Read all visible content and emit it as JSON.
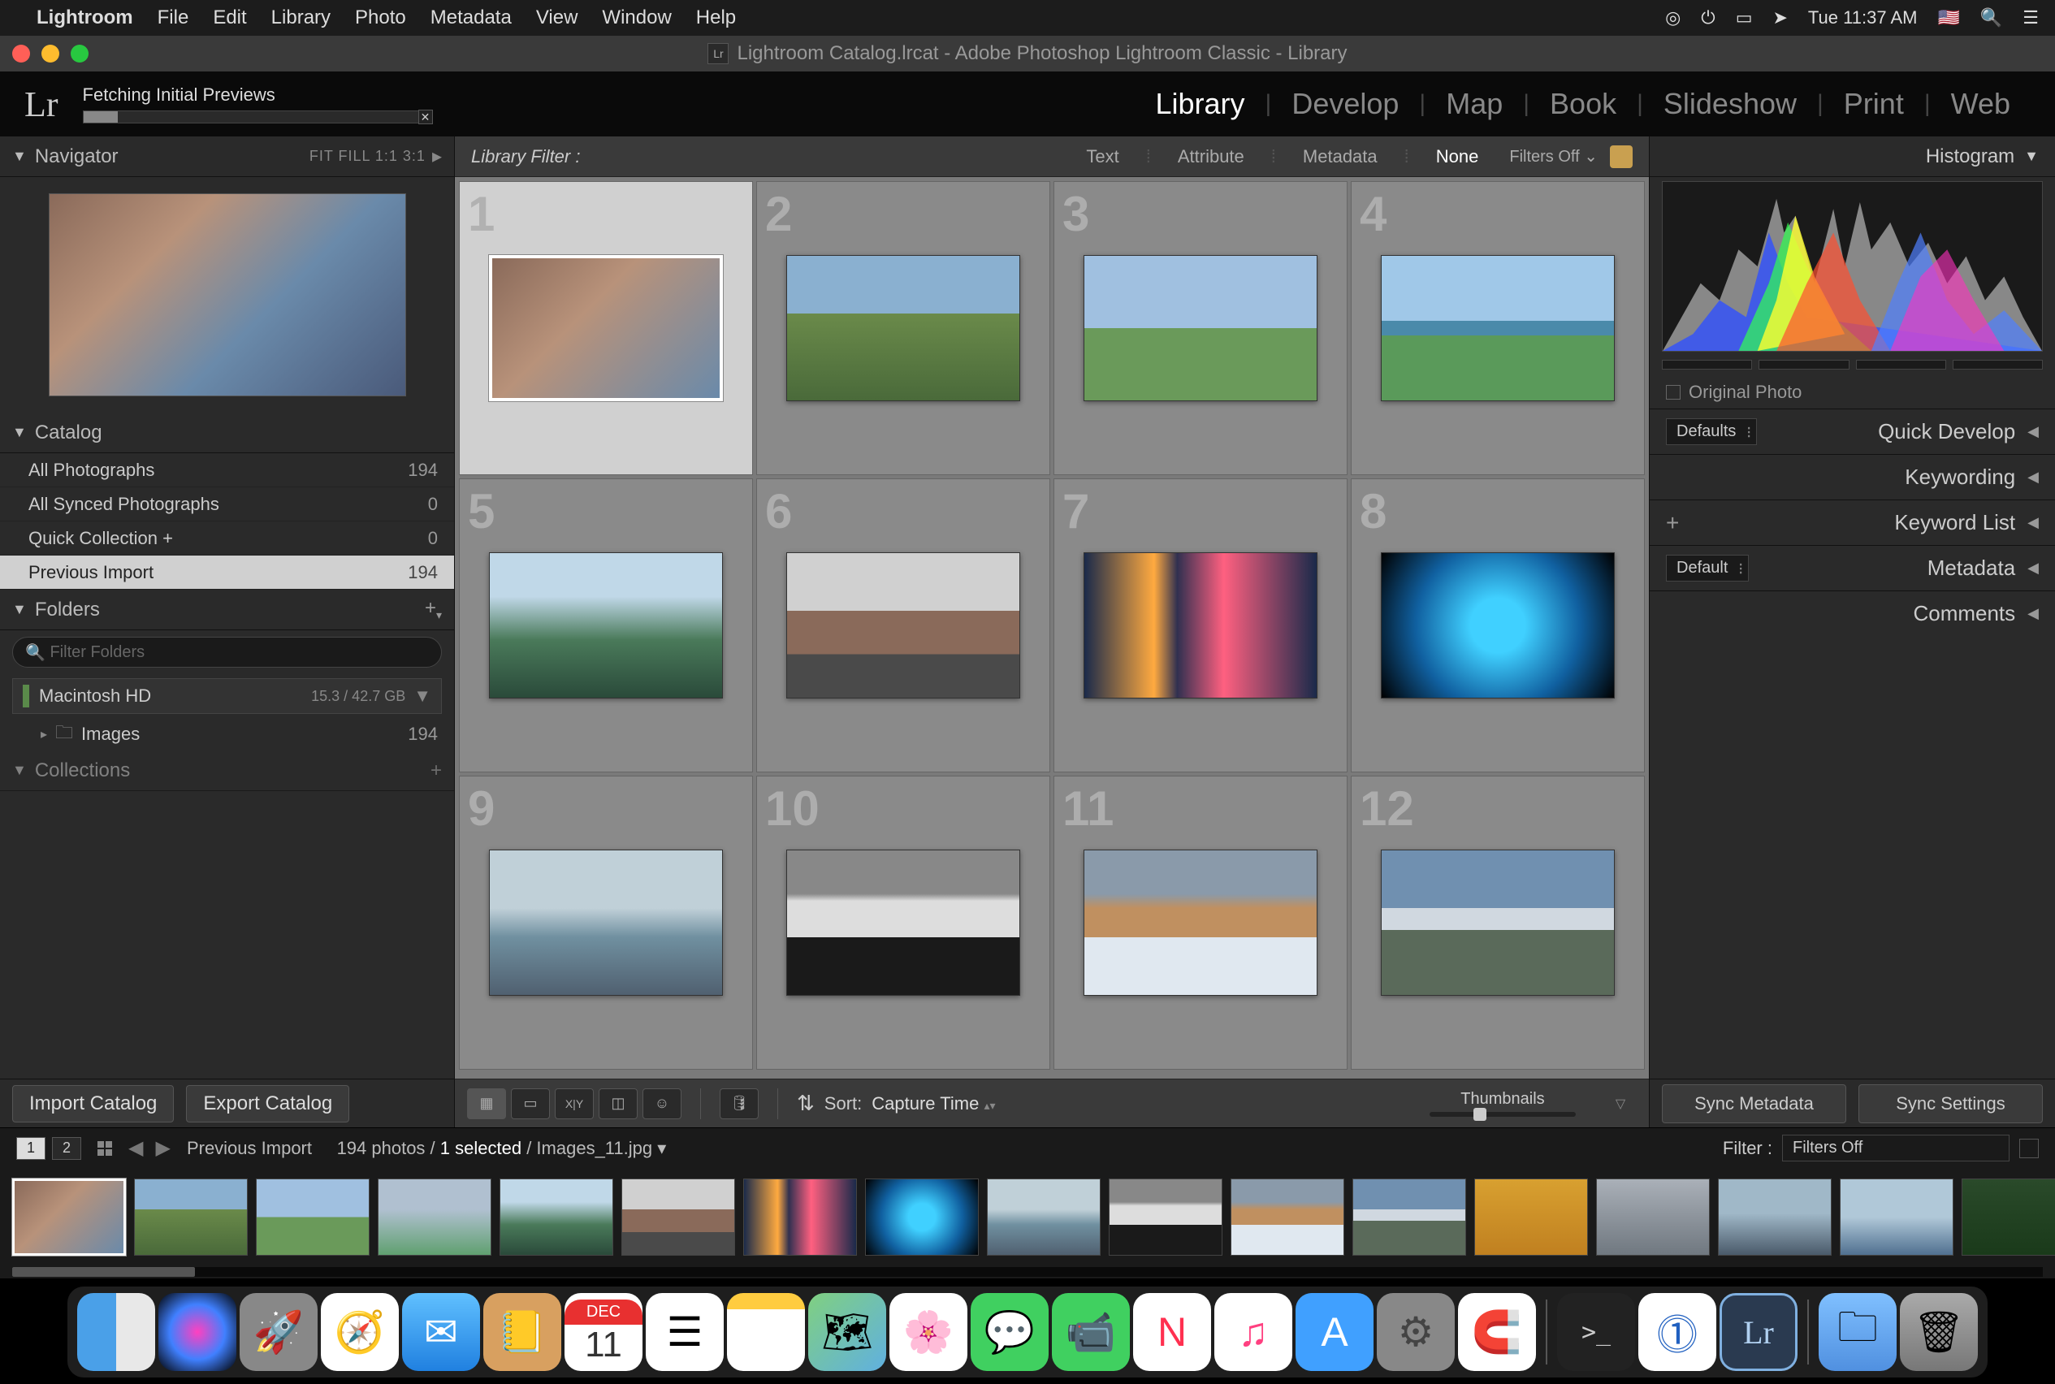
{
  "menubar": {
    "app": "Lightroom",
    "items": [
      "File",
      "Edit",
      "Library",
      "Photo",
      "Metadata",
      "View",
      "Window",
      "Help"
    ],
    "time": "Tue 11:37 AM"
  },
  "window": {
    "title": "Lightroom Catalog.lrcat - Adobe Photoshop Lightroom Classic - Library"
  },
  "status": {
    "text": "Fetching Initial Previews"
  },
  "modules": [
    "Library",
    "Develop",
    "Map",
    "Book",
    "Slideshow",
    "Print",
    "Web"
  ],
  "active_module": "Library",
  "navigator": {
    "title": "Navigator",
    "opts": "FIT   FILL   1:1   3:1"
  },
  "catalog": {
    "title": "Catalog",
    "rows": [
      {
        "label": "All Photographs",
        "count": "194"
      },
      {
        "label": "All Synced Photographs",
        "count": "0"
      },
      {
        "label": "Quick Collection  +",
        "count": "0"
      },
      {
        "label": "Previous Import",
        "count": "194"
      }
    ]
  },
  "folders": {
    "title": "Folders",
    "filter_placeholder": "Filter Folders",
    "volume": {
      "name": "Macintosh HD",
      "size": "15.3 / 42.7 GB"
    },
    "items": [
      {
        "name": "Images",
        "count": "194"
      }
    ]
  },
  "collections": {
    "title": "Collections"
  },
  "left_buttons": {
    "import": "Import Catalog",
    "export": "Export Catalog"
  },
  "filter_bar": {
    "label": "Library Filter :",
    "opts": [
      "Text",
      "Attribute",
      "Metadata",
      "None"
    ],
    "active": "None",
    "off": "Filters Off"
  },
  "toolbar": {
    "sort_label": "Sort:",
    "sort_value": "Capture Time",
    "thumb_label": "Thumbnails"
  },
  "right": {
    "histogram": "Histogram",
    "original": "Original Photo",
    "quick_develop": {
      "dd": "Defaults",
      "label": "Quick Develop"
    },
    "keywording": "Keywording",
    "keyword_list": "Keyword List",
    "metadata": {
      "dd": "Default",
      "label": "Metadata"
    },
    "comments": "Comments",
    "sync_meta": "Sync Metadata",
    "sync_settings": "Sync Settings"
  },
  "filmstrip_bar": {
    "source": "Previous Import",
    "count": "194 photos",
    "selected": "1 selected",
    "file": "Images_11.jpg",
    "filter_label": "Filter :",
    "filter_value": "Filters Off"
  },
  "calendar": {
    "month": "DEC",
    "day": "11"
  },
  "grid_numbers": [
    "1",
    "2",
    "3",
    "4",
    "5",
    "6",
    "7",
    "8",
    "9",
    "10",
    "11",
    "12"
  ]
}
